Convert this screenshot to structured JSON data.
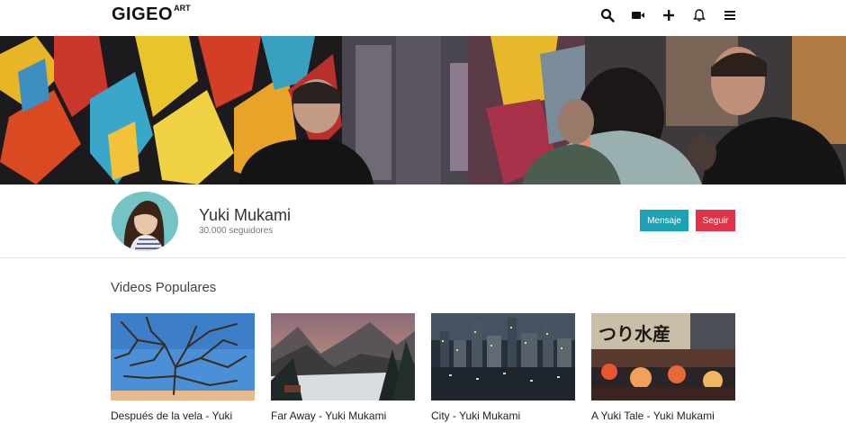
{
  "header": {
    "logo": "GIGEO",
    "logo_sup": "ART",
    "icons": [
      "search-icon",
      "video-camera-icon",
      "plus-icon",
      "bell-icon",
      "menu-icon"
    ]
  },
  "profile": {
    "name": "Yuki Mukami",
    "followers": "30.000 seguidores",
    "message_label": "Mensaje",
    "follow_label": "Seguir"
  },
  "colors": {
    "message_button": "#1da2b3",
    "follow_button": "#e0344b"
  },
  "section": {
    "title": "Videos Populares"
  },
  "videos": [
    {
      "title": "Después de la vela - Yuki"
    },
    {
      "title": "Far Away - Yuki Mukami"
    },
    {
      "title": "City - Yuki Mukami"
    },
    {
      "title": "A Yuki Tale - Yuki Mukami"
    }
  ]
}
